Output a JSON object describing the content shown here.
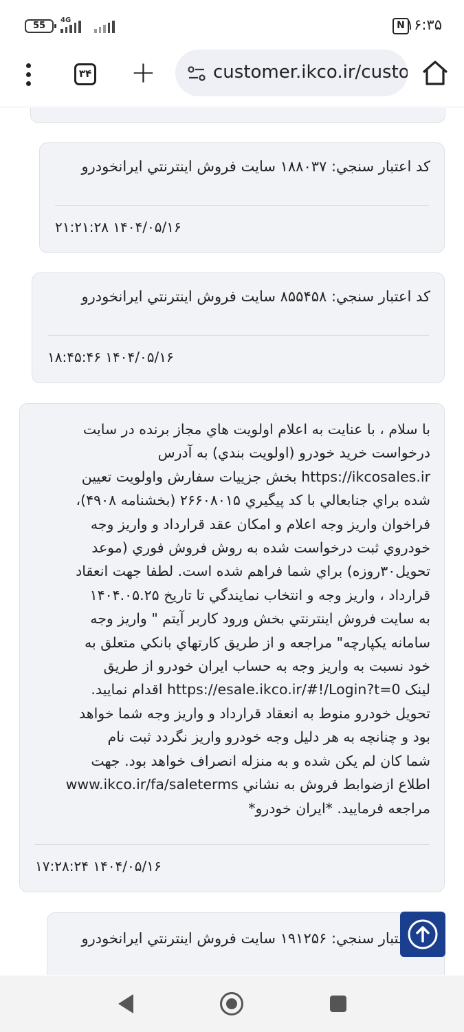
{
  "status_bar": {
    "time": "۱۶:۳۵",
    "battery": "55",
    "network": "4G"
  },
  "browser": {
    "tab_count": "۳۴",
    "url": "customer.ikco.ir/custo"
  },
  "messages": [
    {
      "title": "کد اعتبار سنجي: ۱۸۸۰۳۷ سايت فروش اينترنتي ايرانخودرو",
      "date": "۲۱:۲۱:۲۸ ۱۴۰۴/۰۵/۱۶"
    },
    {
      "title": "کد اعتبار سنجي: ۸۵۵۴۵۸ سايت فروش اينترنتي ايرانخودرو",
      "date": "۱۸:۴۵:۴۶ ۱۴۰۴/۰۵/۱۶"
    },
    {
      "body_lines": [
        "با سلام ، با عنايت به اعلام اولويت هاي مجاز برنده در سايت",
        "درخواست خريد خودرو (اولويت بندي) به آدرس",
        "https://ikcosales.ir بخش جزييات سفارش واولويت تعيين",
        "شده براي جنابعالي با کد پيگيري ۲۶۶۰۸۰۱۵ (بخشنامه ۴۹۰۸)،",
        "فراخوان واريز وجه اعلام و امکان عقد قرارداد و واريز وجه",
        "خودروي ثبت درخواست شده به روش فروش فوري (موعد",
        "تحويل۳۰روزه) براي شما فراهم شده است. لطفا جهت انعقاد",
        "قرارداد ، واريز وجه و انتخاب نمايندگي تا تاريخ ۱۴۰۴.۰۵.۲۵",
        "به سايت فروش اينترنتي بخش ورود کاربر آيتم \" واريز وجه",
        "سامانه يکپارچه\" مراجعه و از طريق کارتهاي بانکي متعلق به",
        "خود نسبت به واريز وجه به حساب ايران خودرو از طريق",
        "لينک https://esale.ikco.ir/#!/Login?t=0 اقدام نماييد.",
        "تحويل خودرو منوط به انعقاد قرارداد و واريز وجه شما خواهد",
        "بود و چنانچه به هر دليل وجه خودرو واريز نگردد ثبت نام",
        "شما کان لم يکن شده و به منزله انصراف خواهد بود. جهت",
        "اطلاع ازضوابط فروش به نشاني www.ikco.ir/fa/saleterms",
        "مراجعه فرماييد. *ايران خودرو*"
      ],
      "date": "۱۷:۲۸:۲۴ ۱۴۰۴/۰۵/۱۶"
    },
    {
      "title": "کد اعتبار سنجي: ۱۹۱۲۵۶ سايت فروش اينترنتي ايرانخودرو"
    }
  ]
}
